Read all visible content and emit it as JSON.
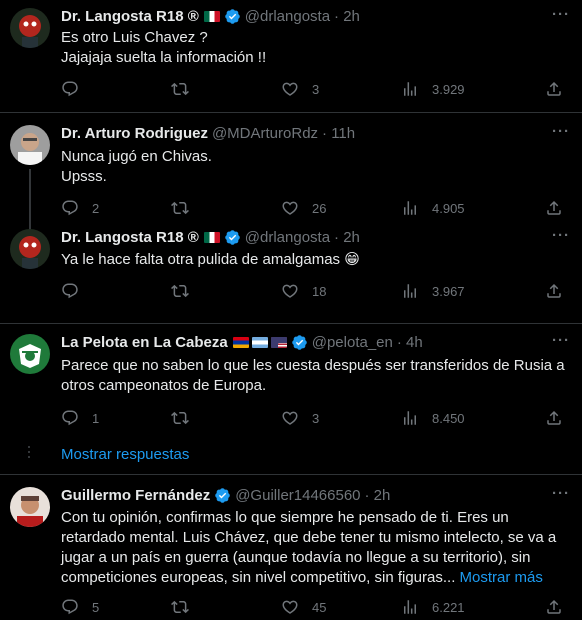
{
  "tweets": [
    {
      "name": "Dr. Langosta R18 ®",
      "handle": "@drlangosta",
      "time": "· 2h",
      "text": "Es otro Luis Chavez ?\nJajajaja suelta la información !!",
      "replies": "",
      "likes": "3",
      "views": "3.929"
    },
    {
      "name": "Dr. Arturo Rodriguez",
      "handle": "@MDArturoRdz",
      "time": "· 11h",
      "text": "Nunca jugó en Chivas.\nUpsss.",
      "replies": "2",
      "likes": "26",
      "views": "4.905"
    },
    {
      "name": "Dr. Langosta R18 ®",
      "handle": "@drlangosta",
      "time": "· 2h",
      "text": "Ya le hace falta otra pulida de amalgamas 😁",
      "replies": "",
      "likes": "18",
      "views": "3.967"
    },
    {
      "name": "La Pelota en La Cabeza",
      "handle": "@pelota_en",
      "time": "· 4h",
      "text": "Parece que no saben lo que les cuesta después ser transferidos de Rusia a otros campeonatos de Europa.",
      "replies": "1",
      "likes": "3",
      "views": "8.450"
    },
    {
      "name": "Guillermo Fernández",
      "handle": "@Guiller14466560",
      "time": "· 2h",
      "text": "Con tu opinión, confirmas lo que siempre he pensado de ti. Eres un retardado mental. Luis Chávez, que debe tener tu mismo intelecto, se va a jugar a un país en guerra (aunque todavía no llegue a su territorio), sin competiciones europeas, sin nivel competitivo, sin figuras...",
      "show_more": "Mostrar más",
      "replies": "5",
      "likes": "45",
      "views": "6.221"
    }
  ],
  "show_replies_label": "Mostrar respuestas",
  "more_label": "···",
  "colors": {
    "accent": "#1d9bf0",
    "verified": "#1d9bf0",
    "muted": "#71767b",
    "divider": "#2f3336"
  },
  "icons": [
    "reply-icon",
    "retweet-icon",
    "like-icon",
    "views-icon",
    "share-icon",
    "verified-badge-icon",
    "more-icon"
  ]
}
